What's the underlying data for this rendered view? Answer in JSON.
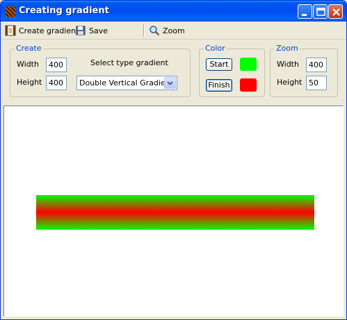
{
  "window": {
    "title": "Creating gradient"
  },
  "toolbar": {
    "create_label": "Create gradient",
    "save_label": "Save",
    "zoom_label": "Zoom"
  },
  "create_group": {
    "legend": "Create",
    "width_label": "Width",
    "width_value": "400",
    "height_label": "Height",
    "height_value": "400",
    "select_label": "Select type gradient",
    "select_value": "Double Vertical Gradient"
  },
  "color_group": {
    "legend": "Color",
    "start_label": "Start",
    "finish_label": "Finish",
    "start_color": "#00ff00",
    "finish_color": "#ff0000"
  },
  "zoom_group": {
    "legend": "Zoom",
    "width_label": "Width",
    "width_value": "400",
    "height_label": "Height",
    "height_value": "50"
  },
  "gradient": {
    "type": "double-vertical",
    "start_color": "#00ff00",
    "finish_color": "#ff0000"
  }
}
